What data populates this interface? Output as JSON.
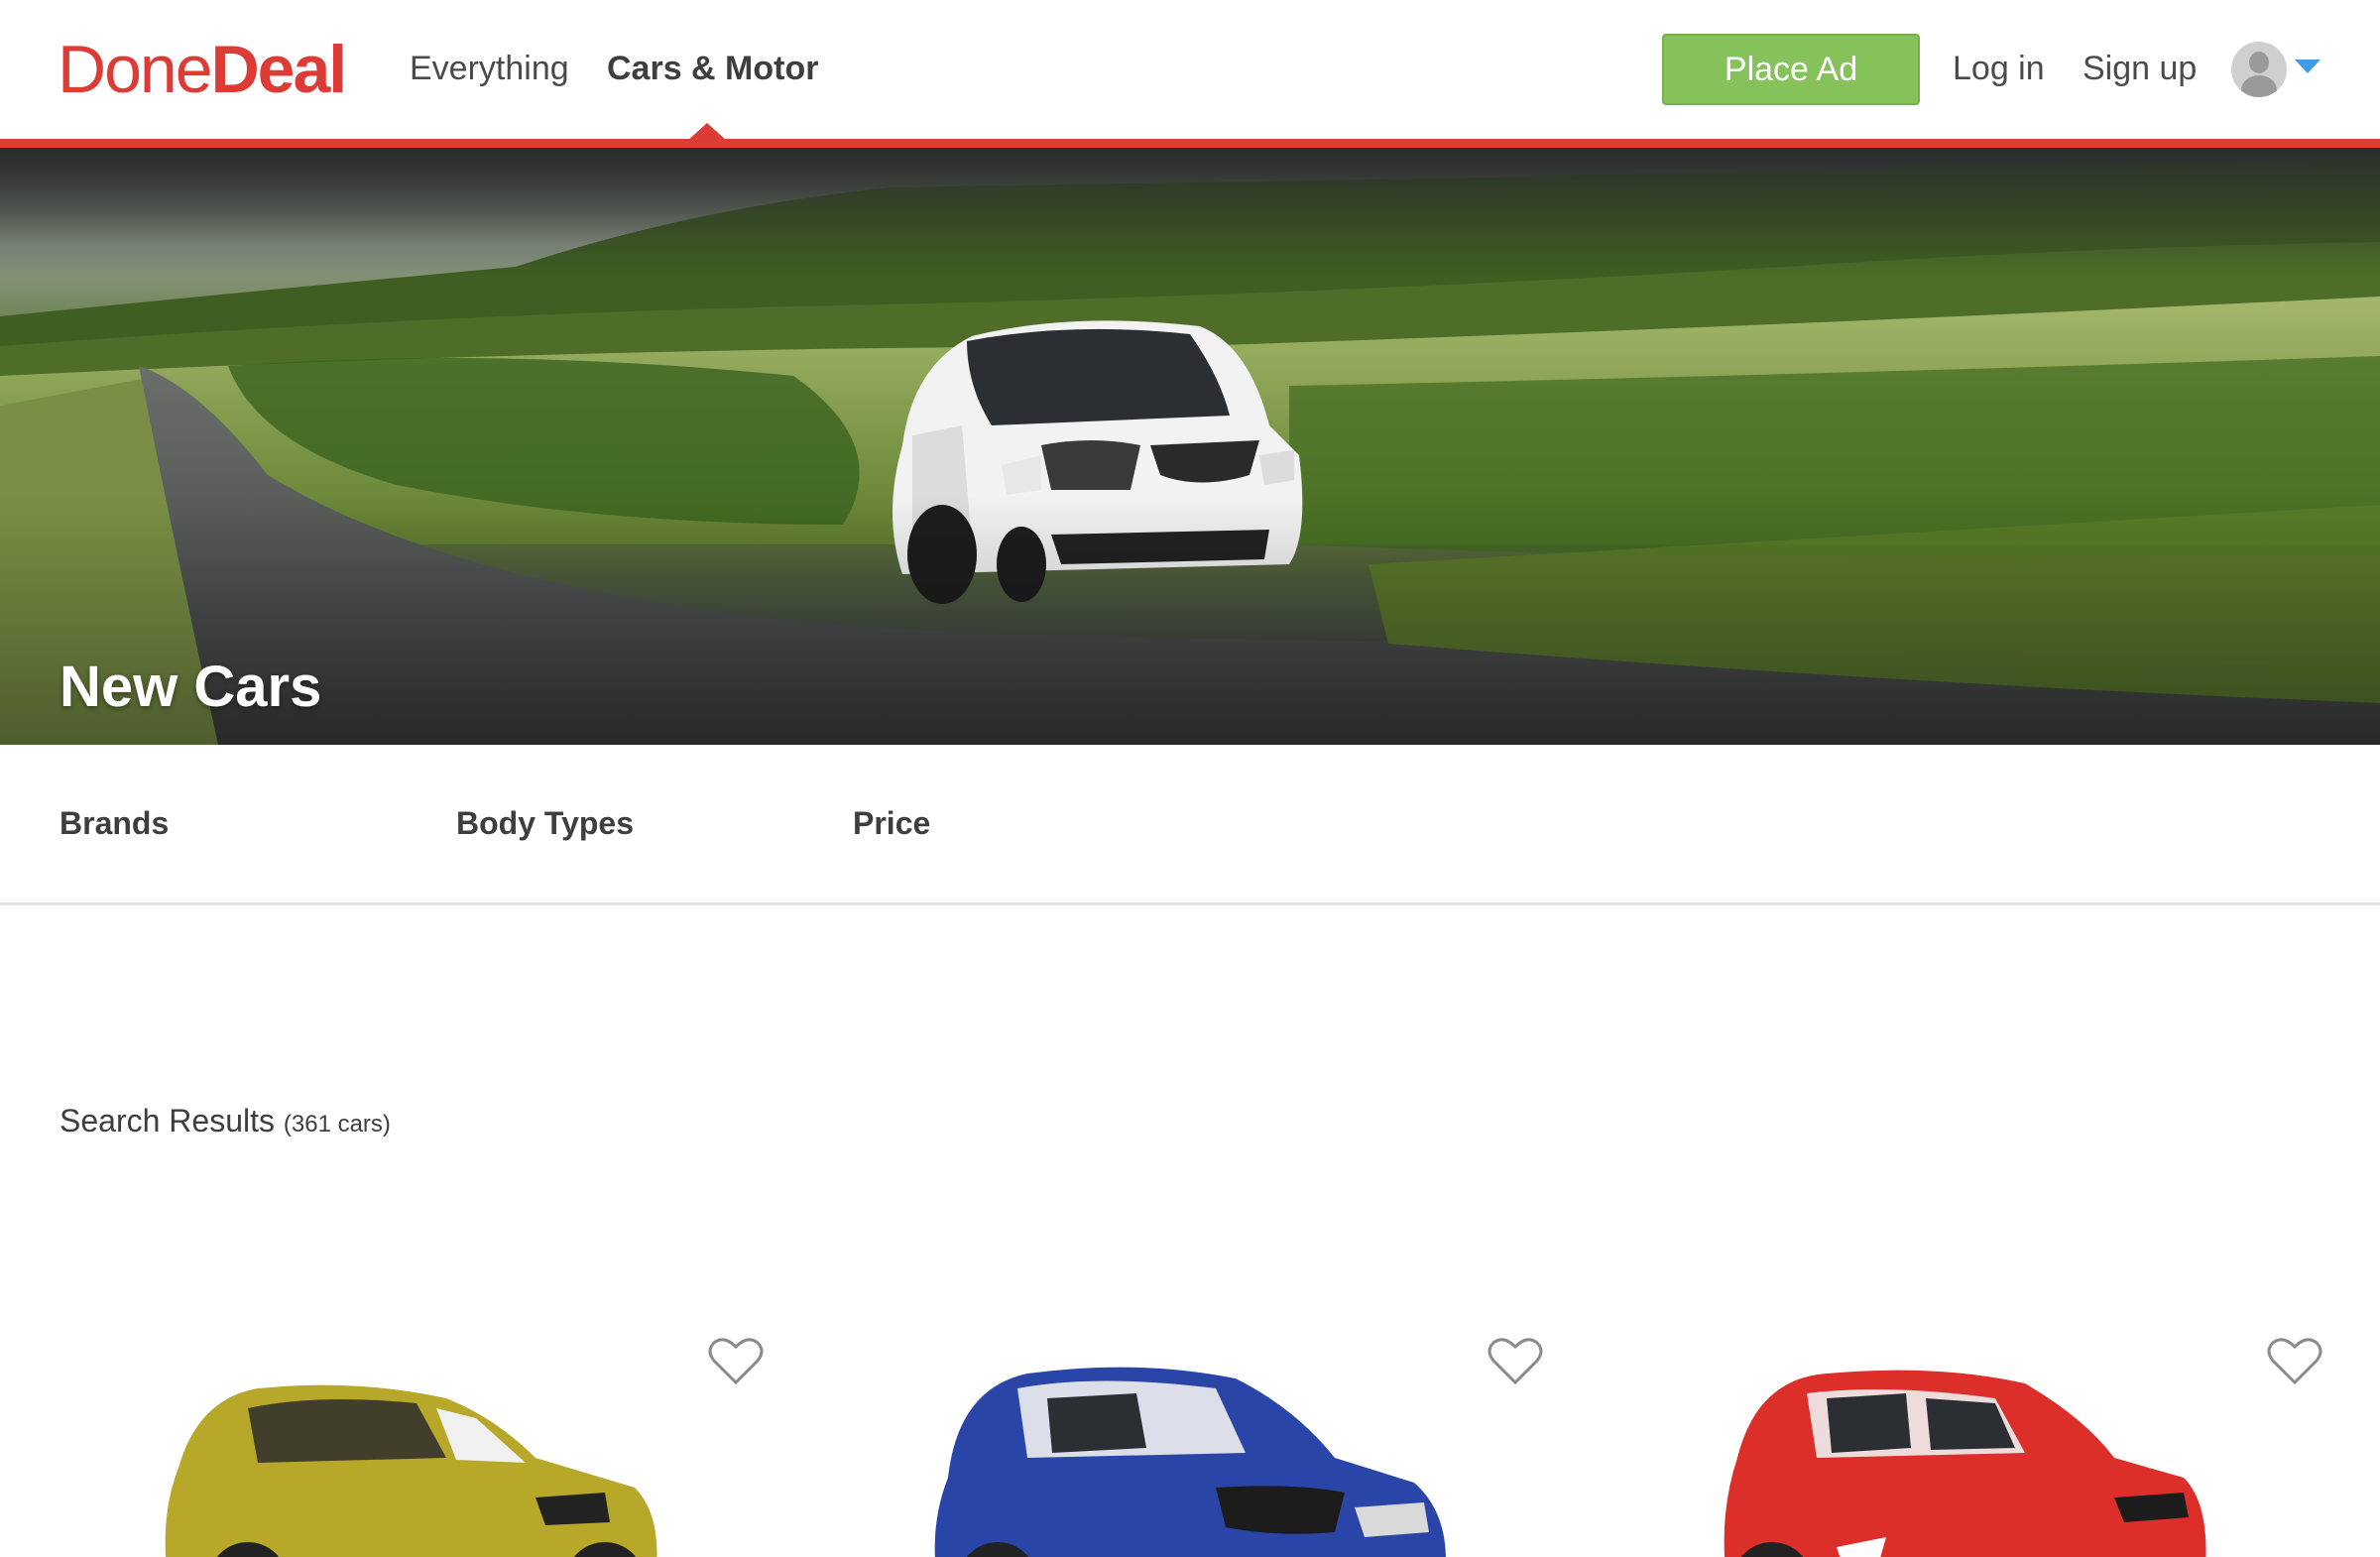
{
  "header": {
    "logo": {
      "part1": "Done",
      "part2": "Deal"
    },
    "nav": [
      {
        "label": "Everything"
      },
      {
        "label": "Cars & Motor",
        "active": true
      }
    ],
    "place_ad_label": "Place Ad",
    "login_label": "Log in",
    "signup_label": "Sign up",
    "avatar_icon": "user-avatar-icon",
    "dropdown_icon": "caret-down-icon"
  },
  "hero": {
    "title": "New Cars"
  },
  "filters": {
    "tabs": [
      {
        "label": "Brands"
      },
      {
        "label": "Body Types"
      },
      {
        "label": "Price"
      }
    ]
  },
  "results": {
    "title": "Search Results",
    "count_text": "(361 cars)",
    "cards": [
      {
        "car_color": "#b8a82a",
        "favorite_icon": "heart-outline-icon"
      },
      {
        "car_color": "#2a45a8",
        "favorite_icon": "heart-outline-icon"
      },
      {
        "car_color": "#dd2f2a",
        "favorite_icon": "heart-outline-icon"
      }
    ]
  },
  "colors": {
    "brand_red": "#dd3b36",
    "place_ad_green": "#85c25a",
    "caret_blue": "#3d9be9"
  }
}
